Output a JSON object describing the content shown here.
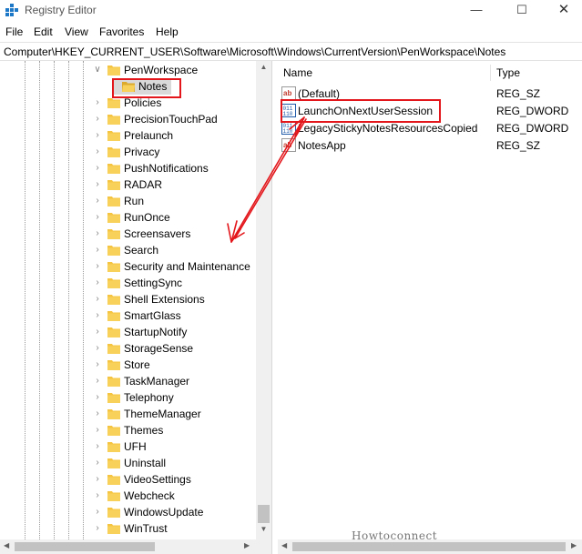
{
  "window": {
    "title": "Registry Editor",
    "icons": {
      "app": "registry-editor-icon",
      "minimize": "minimize-icon",
      "maximize": "maximize-icon",
      "close": "close-icon"
    }
  },
  "menu": [
    "File",
    "Edit",
    "View",
    "Favorites",
    "Help"
  ],
  "address": "Computer\\HKEY_CURRENT_USER\\Software\\Microsoft\\Windows\\CurrentVersion\\PenWorkspace\\Notes",
  "tree": {
    "expanded_parent": "PenWorkspace",
    "selected_child": "Notes",
    "items": [
      "Policies",
      "PrecisionTouchPad",
      "Prelaunch",
      "Privacy",
      "PushNotifications",
      "RADAR",
      "Run",
      "RunOnce",
      "Screensavers",
      "Search",
      "Security and Maintenance",
      "SettingSync",
      "Shell Extensions",
      "SmartGlass",
      "StartupNotify",
      "StorageSense",
      "Store",
      "TaskManager",
      "Telephony",
      "ThemeManager",
      "Themes",
      "UFH",
      "Uninstall",
      "VideoSettings",
      "Webcheck",
      "WindowsUpdate",
      "WinTrust"
    ]
  },
  "values_pane": {
    "columns": {
      "name": "Name",
      "type": "Type"
    },
    "rows": [
      {
        "name": "(Default)",
        "type": "REG_SZ",
        "icon": "string-value-icon"
      },
      {
        "name": "LaunchOnNextUserSession",
        "type": "REG_DWORD",
        "icon": "dword-value-icon"
      },
      {
        "name": "LegacyStickyNotesResourcesCopied",
        "type": "REG_DWORD",
        "icon": "dword-value-icon"
      },
      {
        "name": "NotesApp",
        "type": "REG_SZ",
        "icon": "string-value-icon"
      }
    ]
  },
  "annotation": {
    "highlight_color": "#e3161b"
  },
  "colors": {
    "folder": "#f5c542",
    "folder_dark": "#dcaa2c",
    "scrollbar": "#f0f0f0",
    "scroll_thumb": "#c2c2c2"
  },
  "watermark": "Howtoconnect"
}
